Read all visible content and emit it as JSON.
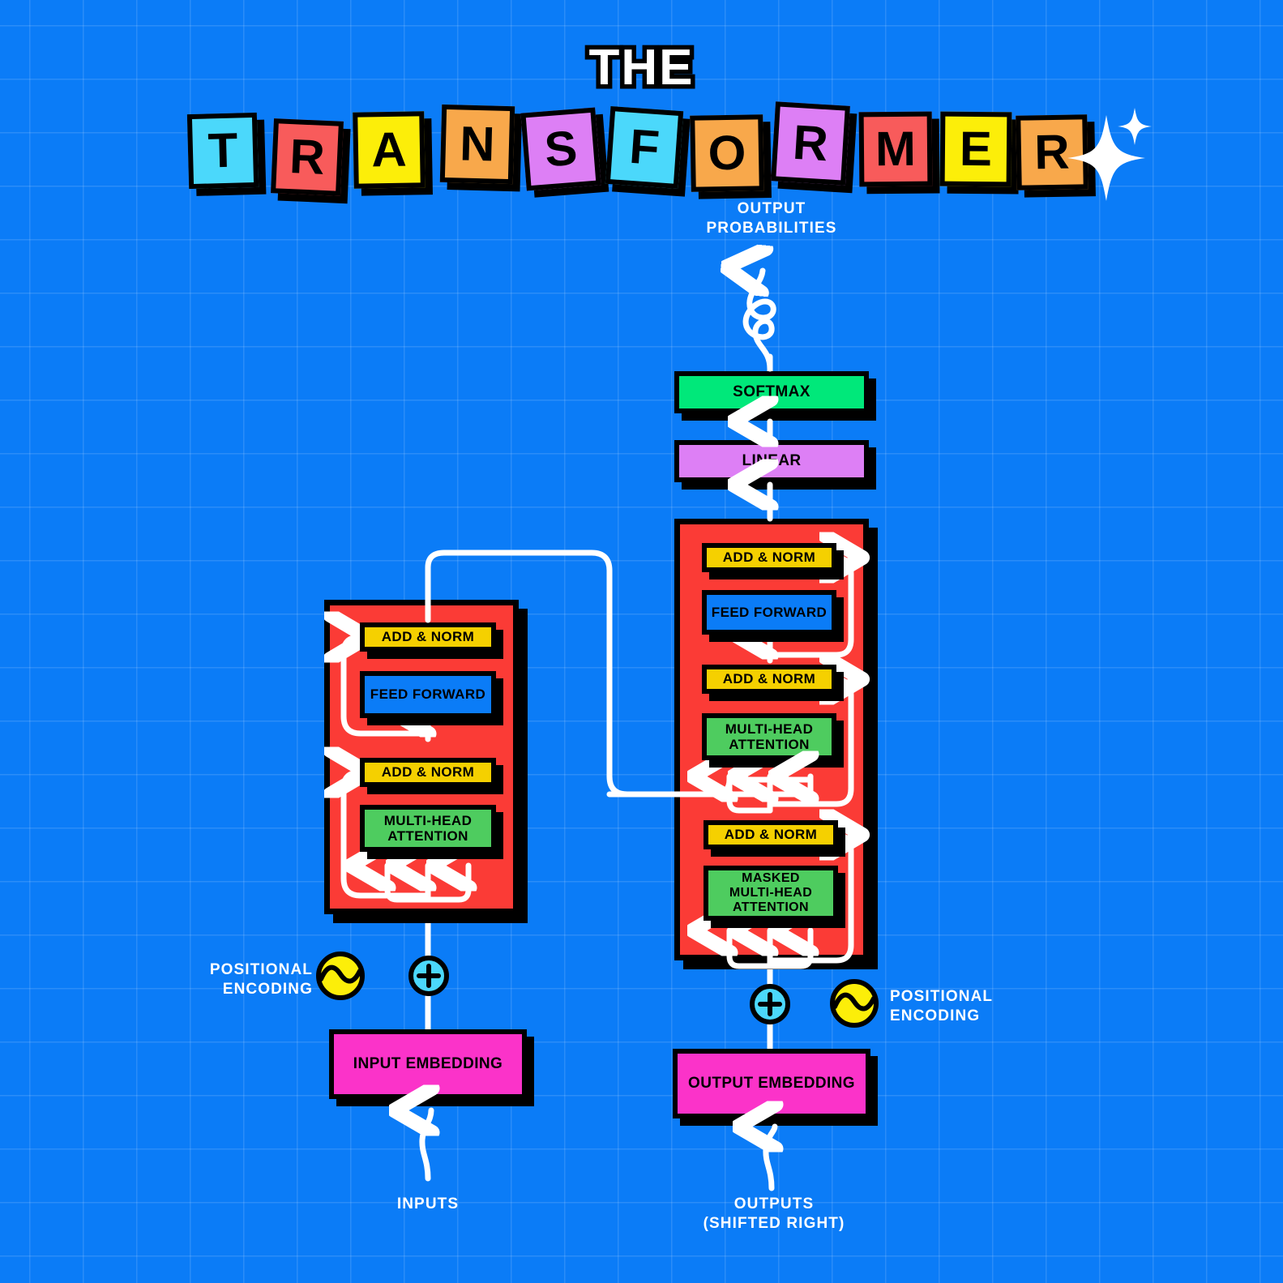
{
  "meta": {
    "background_color": "#0B7CF7",
    "grid_color": "rgba(255,255,255,0.13)"
  },
  "title": {
    "line1": "THE",
    "word": "TRANSFORMER",
    "letters": [
      {
        "char": "T",
        "color": "#4BD8FB"
      },
      {
        "char": "R",
        "color": "#F85B5B"
      },
      {
        "char": "A",
        "color": "#FCEE09"
      },
      {
        "char": "N",
        "color": "#F8A84B"
      },
      {
        "char": "S",
        "color": "#DD7FF5"
      },
      {
        "char": "F",
        "color": "#4BD8FB"
      },
      {
        "char": "O",
        "color": "#F8A84B"
      },
      {
        "char": "R",
        "color": "#DD7FF5"
      },
      {
        "char": "M",
        "color": "#F85B5B"
      },
      {
        "char": "E",
        "color": "#FCEE09"
      },
      {
        "char": "R",
        "color": "#F8A84B"
      }
    ],
    "sparkle_large": "sparkle-icon",
    "sparkle_small": "sparkle-icon"
  },
  "colors": {
    "stack_red": "#FB3B36",
    "add_norm_yellow": "#F5D000",
    "feed_forward_blue": "#0B7CF7",
    "attention_green": "#4ECC5F",
    "softmax_green": "#00E87A",
    "linear_purple": "#DD7FF5",
    "embedding_pink": "#FB33C9",
    "pos_encoding_yellow": "#FCEE09",
    "plus_cyan": "#4BD8FB",
    "outline_black": "#000000",
    "wire_white": "#FFFFFF"
  },
  "output_head": {
    "probabilities_label_line1": "OUTPUT",
    "probabilities_label_line2": "PROBABILITIES",
    "softmax_label": "SOFTMAX",
    "linear_label": "LINEAR"
  },
  "encoder": {
    "name": "encoder-stack",
    "blocks": [
      {
        "label": "ADD & NORM",
        "type": "add-norm"
      },
      {
        "label": "FEED FORWARD",
        "type": "feed-forward"
      },
      {
        "label": "ADD & NORM",
        "type": "add-norm"
      },
      {
        "label": "MULTI-HEAD\nATTENTION",
        "line1": "MULTI-HEAD",
        "line2": "ATTENTION",
        "type": "multi-head-attention"
      }
    ],
    "positional_encoding_label_line1": "POSITIONAL",
    "positional_encoding_label_line2": "ENCODING",
    "embedding_label": "INPUT EMBEDDING",
    "source_label": "INPUTS",
    "plus_symbol": "+"
  },
  "decoder": {
    "name": "decoder-stack",
    "blocks": [
      {
        "label": "ADD & NORM",
        "type": "add-norm"
      },
      {
        "label": "FEED FORWARD",
        "type": "feed-forward"
      },
      {
        "label": "ADD & NORM",
        "type": "add-norm"
      },
      {
        "label": "MULTI-HEAD\nATTENTION",
        "line1": "MULTI-HEAD",
        "line2": "ATTENTION",
        "type": "multi-head-attention"
      },
      {
        "label": "ADD & NORM",
        "type": "add-norm"
      },
      {
        "label": "MASKED MULTI-HEAD ATTENTION",
        "line1": "MASKED",
        "line2": "MULTI-HEAD",
        "line3": "ATTENTION",
        "type": "masked-multi-head-attention"
      }
    ],
    "positional_encoding_label_line1": "POSITIONAL",
    "positional_encoding_label_line2": "ENCODING",
    "embedding_label": "OUTPUT EMBEDDING",
    "source_label_line1": "OUTPUTS",
    "source_label_line2": "(SHIFTED RIGHT)",
    "plus_symbol": "+"
  }
}
